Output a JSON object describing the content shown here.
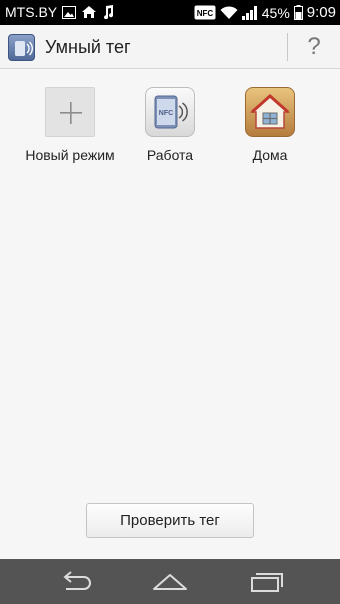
{
  "status_bar": {
    "carrier": "MTS.BY",
    "battery": "45%",
    "time": "9:09",
    "icons": [
      "image-icon",
      "home-icon",
      "music-icon",
      "nfc-icon",
      "wifi-icon",
      "signal-icon",
      "battery-icon"
    ],
    "nfc_badge": "NFC"
  },
  "action_bar": {
    "title": "Умный тег",
    "icon": "nfc-tag-app-icon",
    "help_label": "?"
  },
  "modes": [
    {
      "label": "Новый режим",
      "icon": "plus-icon"
    },
    {
      "label": "Работа",
      "icon": "nfc-icon",
      "badge": "NFC"
    },
    {
      "label": "Дома",
      "icon": "house-icon"
    }
  ],
  "check_button_label": "Проверить тег",
  "nav_bar": {
    "buttons": [
      "back-icon",
      "home-icon",
      "recent-apps-icon"
    ]
  },
  "colors": {
    "status_bar": "#000000",
    "background": "#f6f6f6",
    "nav_bar": "#545454"
  }
}
